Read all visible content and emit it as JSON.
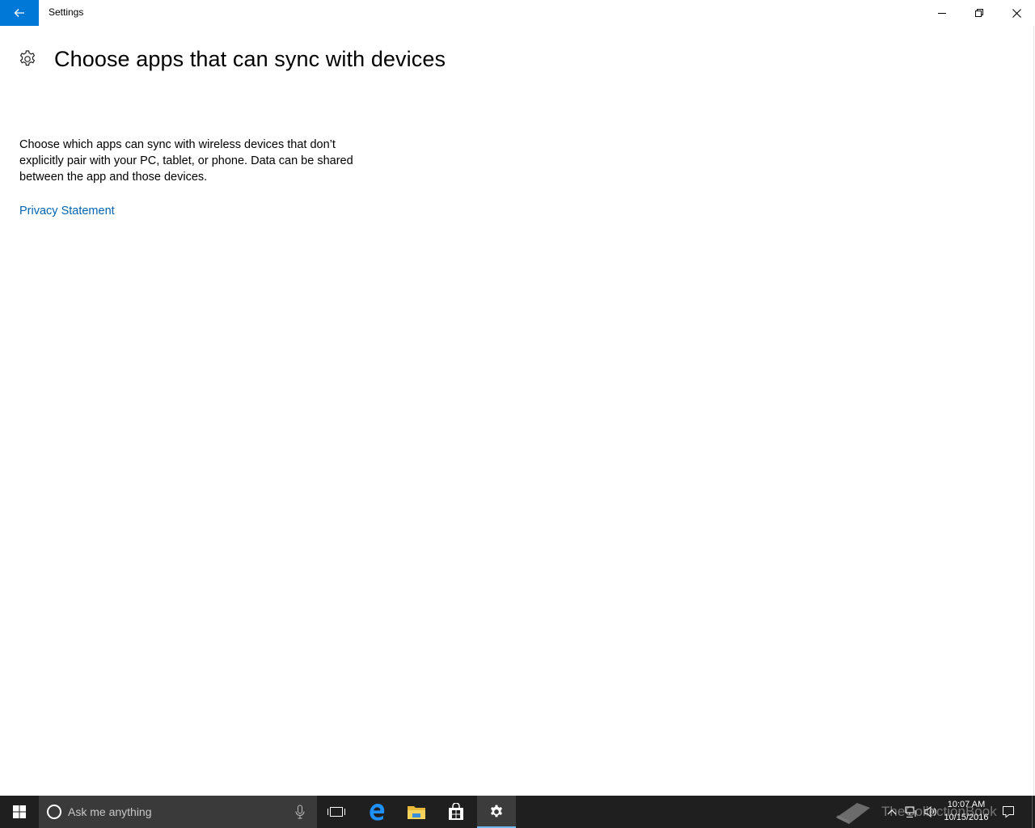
{
  "window": {
    "app_title": "Settings"
  },
  "page": {
    "title": "Choose apps that can sync with devices",
    "description": "Choose which apps can sync with wireless devices that don’t explicitly pair with your PC, tablet, or phone. Data can be shared between the app and those devices.",
    "privacy_link": "Privacy Statement"
  },
  "taskbar": {
    "search_placeholder": "Ask me anything",
    "watermark": "TheCollectionBook",
    "clock_time": "10:07 AM",
    "clock_date": "10/15/2016"
  },
  "colors": {
    "accent": "#0078d7",
    "link": "#0063b1",
    "taskbar": "#1f1f1f",
    "search_box": "#3a3a3a"
  }
}
